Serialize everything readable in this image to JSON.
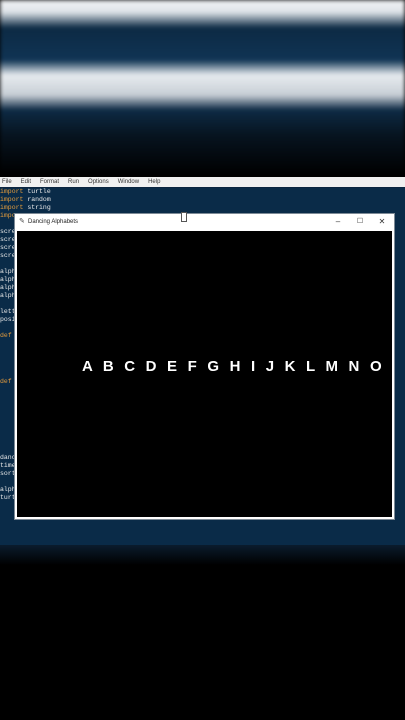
{
  "idle": {
    "menu": [
      "File",
      "Edit",
      "Format",
      "Run",
      "Options",
      "Window",
      "Help"
    ],
    "imports": [
      {
        "kw": "import",
        "name": "turtle"
      },
      {
        "kw": "import",
        "name": "random"
      },
      {
        "kw": "import",
        "name": "string"
      },
      {
        "kw": "impo",
        "name": ""
      }
    ],
    "fragments": [
      "scre",
      "scre",
      "scre",
      "scre",
      "alph",
      "alph",
      "alph",
      "alph",
      "lett",
      "posi",
      "def",
      "def",
      "danc",
      "time",
      "sort",
      "alph",
      "turt"
    ]
  },
  "turtle_window": {
    "title": "Dancing Alphabets",
    "minimize": "–",
    "maximize": "☐",
    "close": "✕",
    "letters": "A B C D E F G H I  J K L M N O P Q R S T U V"
  },
  "colors": {
    "editor_bg": "#0a2b48",
    "keyword": "#e39b3c",
    "canvas_bg": "#000000",
    "letter_color": "#ffffff"
  }
}
